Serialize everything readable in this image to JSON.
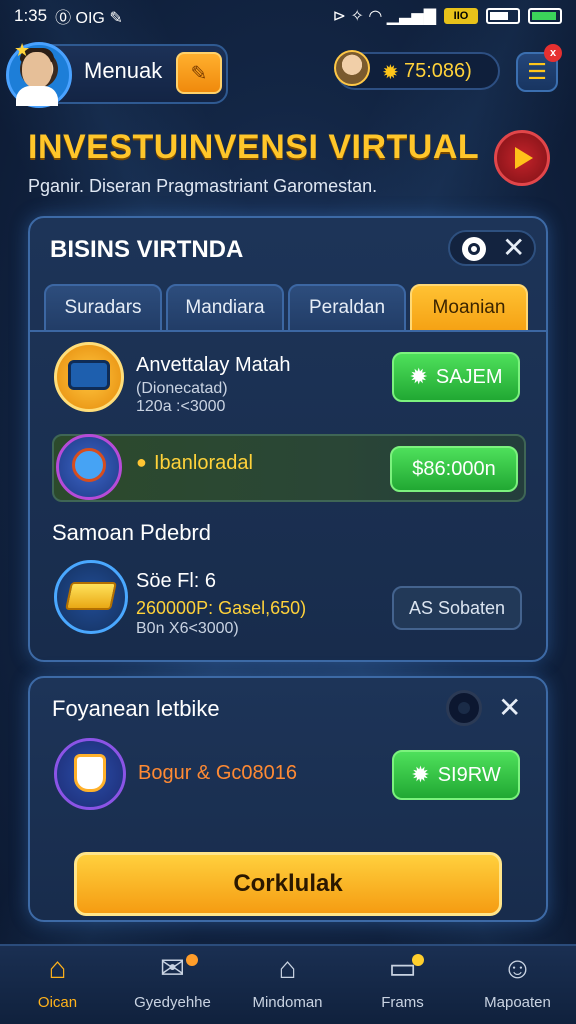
{
  "status_bar": {
    "time": "1:35",
    "left_glyphs": "⓪ OIG ✎",
    "right_glyphs": "⊳ ✧ ◠ ▁▃▅▇",
    "battery_label": "IIO"
  },
  "profile": {
    "name": "Menuak",
    "edit_icon": "pencil-icon",
    "avatar_icon": "avatar"
  },
  "coins": {
    "value": "75:086)",
    "star_icon": "star-icon"
  },
  "menu": {
    "icon": "hamburger-icon",
    "notification": "x"
  },
  "hero": {
    "title": "INVESTUINVENSI VIRTUAL",
    "subtitle": "Pganir. Diseran Pragmastriant Garomestan.",
    "play_icon": "play-icon"
  },
  "panel1": {
    "title": "BISINS VIRTNDA",
    "close": "✕",
    "tabs": [
      {
        "label": "Suradars",
        "active": false
      },
      {
        "label": "Mandiara",
        "active": false
      },
      {
        "label": "Peraldan",
        "active": false
      },
      {
        "label": "Moanian",
        "active": true
      }
    ],
    "items": [
      {
        "title": "Anvettalay Matah",
        "sub1": "(Dionecatad)",
        "sub2": "120a :<3000",
        "button": "SAJEM",
        "button_icon": "✹"
      },
      {
        "title": "Ibanloradal",
        "bullet": "●",
        "button": "$86:000n"
      }
    ],
    "section_title": "Samoan Pdebrd",
    "item3": {
      "title": "Söe Fl: 6",
      "sub1": "260000P: Gasel,650)",
      "sub2": "B0n X6<3000)",
      "button": "AS Sobaten"
    }
  },
  "panel2": {
    "title": "Foyanean letbike",
    "close": "✕",
    "item": {
      "title": "Bogur & Gc08016",
      "button": "SI9RW",
      "button_icon": "✹"
    },
    "cta": "Corklulak"
  },
  "bottom_nav": [
    {
      "label": "Oican",
      "icon": "⌂",
      "active": true
    },
    {
      "label": "Gyedyehhe",
      "icon": "✉",
      "active": false
    },
    {
      "label": "Mindoman",
      "icon": "⌂",
      "active": false
    },
    {
      "label": "Frams",
      "icon": "▭",
      "active": false
    },
    {
      "label": "Mapoaten",
      "icon": "☺",
      "active": false
    }
  ],
  "colors": {
    "accent_gold": "#ffc62a",
    "green_button": "#21a833",
    "orange_button": "#f59c12",
    "background": "#132645"
  }
}
